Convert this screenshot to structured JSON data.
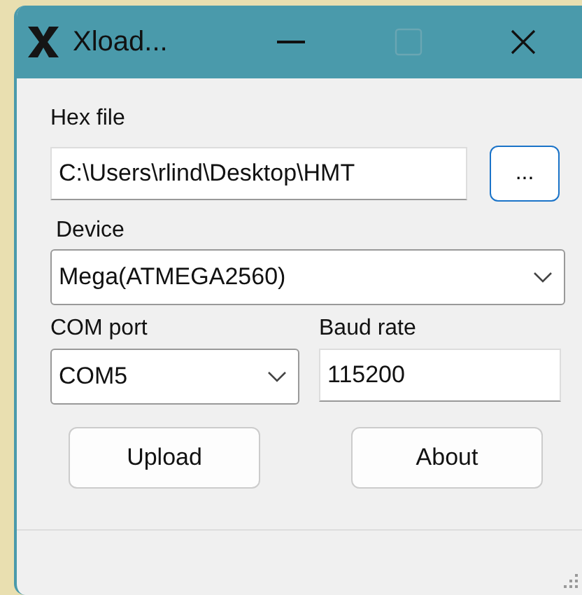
{
  "window": {
    "title": "Xload..."
  },
  "hex_file": {
    "label": "Hex file",
    "value": "C:\\Users\\rlind\\Desktop\\HMT",
    "browse_button": "..."
  },
  "device": {
    "label": "Device",
    "value": "Mega(ATMEGA2560)"
  },
  "com_port": {
    "label": "COM port",
    "value": "COM5"
  },
  "baud_rate": {
    "label": "Baud rate",
    "value": "115200"
  },
  "buttons": [
    "Upload",
    "About"
  ]
}
